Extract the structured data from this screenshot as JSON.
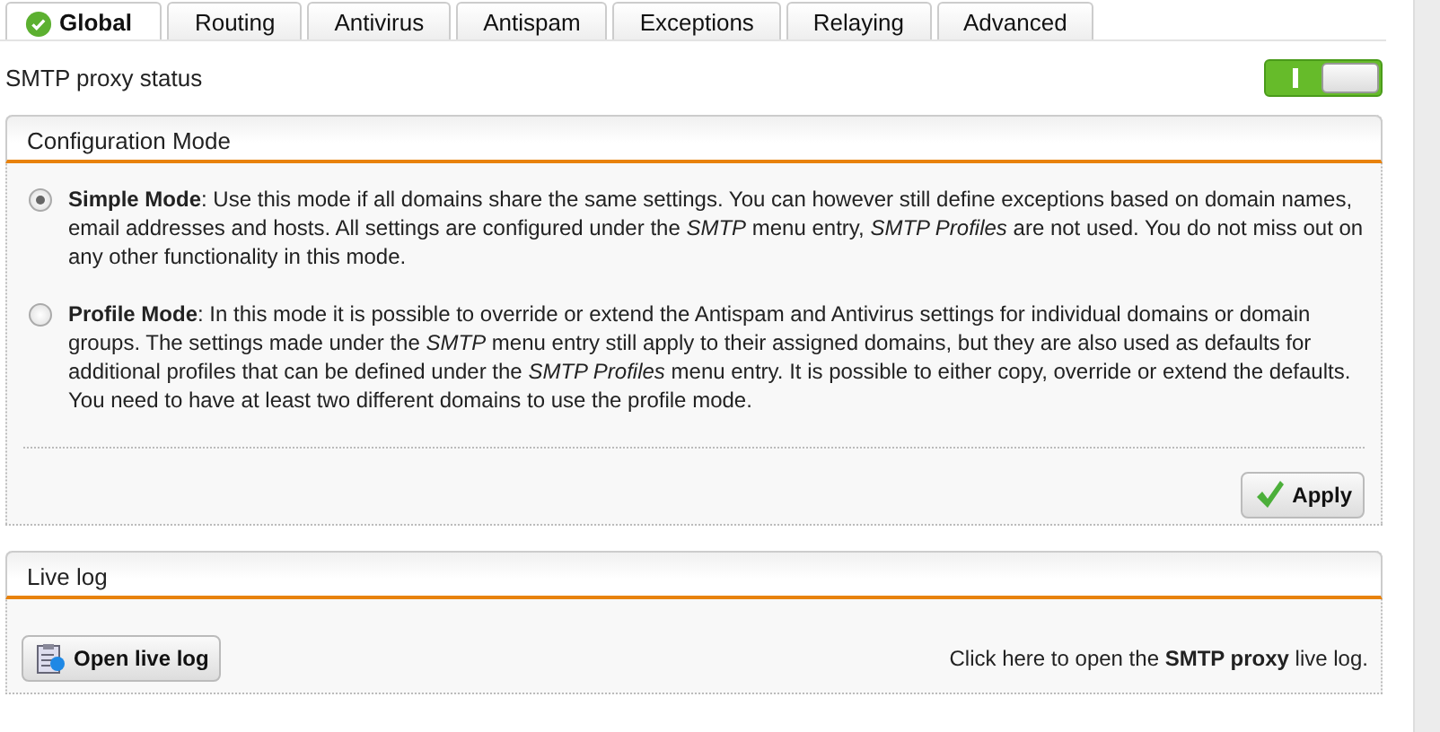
{
  "tabs": [
    {
      "label": "Global",
      "selected": true,
      "valid": true
    },
    {
      "label": "Routing",
      "selected": false
    },
    {
      "label": "Antivirus",
      "selected": false
    },
    {
      "label": "Antispam",
      "selected": false
    },
    {
      "label": "Exceptions",
      "selected": false
    },
    {
      "label": "Relaying",
      "selected": false
    },
    {
      "label": "Advanced",
      "selected": false
    }
  ],
  "status_row": {
    "label": "SMTP proxy status",
    "on": true
  },
  "config_panel": {
    "title": "Configuration Mode",
    "options": [
      {
        "text": "**Simple Mode**: Use this mode if all domains share the same settings. You can however still define exceptions based on domain names, email addresses and hosts. All settings are configured under the *SMTP* menu entry, *SMTP Profiles* are not used. You do not miss out on any other functionality in this mode.",
        "selected": true
      },
      {
        "text": "**Profile Mode**: In this mode it is possible to override or extend the Antispam and Antivirus settings for individual domains or domain groups. The settings made under the *SMTP* menu entry still apply to their assigned domains, but they are also used as defaults for additional profiles that can be defined under the *SMTP Profiles* menu entry. It is possible to either copy, override or extend the defaults. You need to have at least two different domains to use the profile mode.",
        "selected": false
      }
    ],
    "button": "Apply"
  },
  "live_log_panel": {
    "title": "Live log",
    "button": "Open live log",
    "hint": "Click here to open the **SMTP proxy** live log."
  }
}
